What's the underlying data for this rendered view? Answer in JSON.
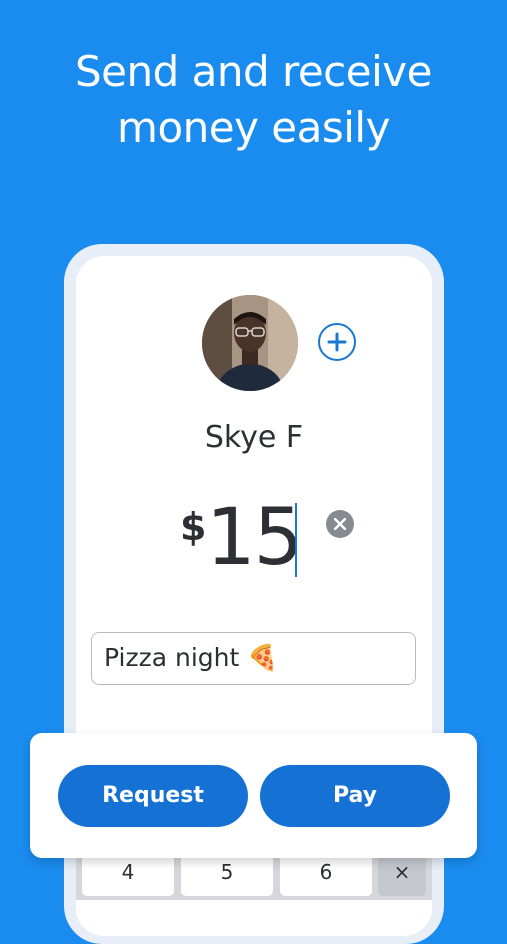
{
  "headline": {
    "line1": "Send and receive",
    "line2": "money easily"
  },
  "recipient": {
    "name": "Skye F"
  },
  "payment": {
    "currency": "$",
    "amount": "15",
    "note": "Pizza night 🍕"
  },
  "keyboard": {
    "keys": [
      "4",
      "5",
      "6",
      "×"
    ]
  },
  "actions": {
    "request_label": "Request",
    "pay_label": "Pay"
  },
  "colors": {
    "background": "#1a8cf0",
    "accent": "#1572d4"
  },
  "icons": {
    "add": "plus-circle-icon",
    "clear": "clear-x-icon"
  }
}
